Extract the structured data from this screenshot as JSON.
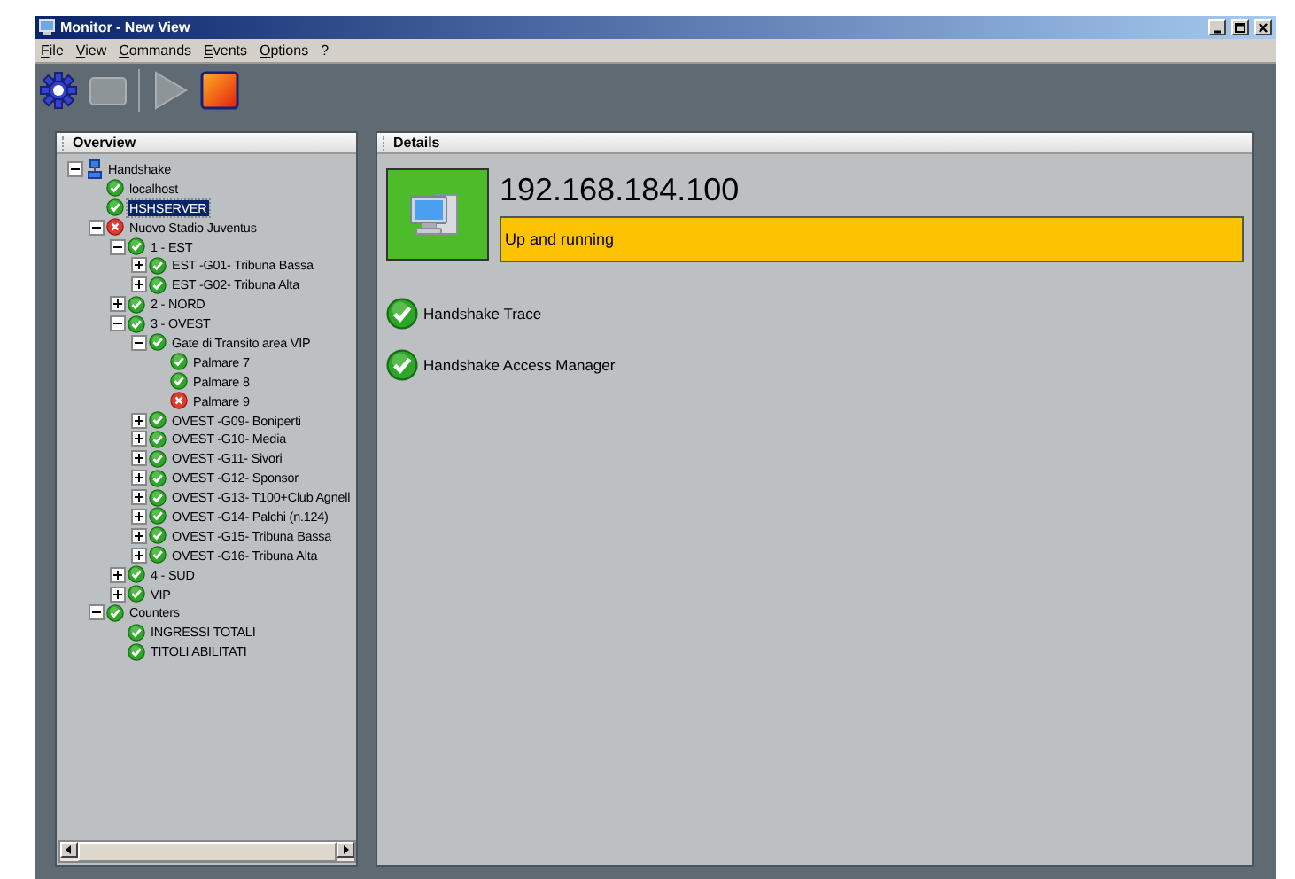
{
  "window": {
    "title": "Monitor - New View"
  },
  "menu": [
    {
      "label": "File"
    },
    {
      "label": "View"
    },
    {
      "label": "Commands"
    },
    {
      "label": "Events"
    },
    {
      "label": "Options"
    },
    {
      "label": "?"
    }
  ],
  "toolbar": [
    {
      "kind": "settings",
      "disabled": false
    },
    {
      "kind": "blank",
      "disabled": true
    },
    {
      "kind": "separator"
    },
    {
      "kind": "play",
      "disabled": true
    },
    {
      "kind": "stop",
      "disabled": false
    }
  ],
  "overview": {
    "title": "Overview",
    "tree": [
      {
        "label": "Handshake",
        "kind": "host",
        "expanded": true,
        "selected": false,
        "children": [
          {
            "label": "localhost",
            "error": false,
            "selected": false
          },
          {
            "label": "HSHSERVER",
            "error": false,
            "selected": true
          },
          {
            "label": "Nuovo Stadio Juventus",
            "error": true,
            "expanded": true,
            "selected": false,
            "children": [
              {
                "label": "1 - EST",
                "error": false,
                "expanded": true,
                "selected": false,
                "children": [
                  {
                    "label": "EST -G01- Tribuna Bassa",
                    "error": false,
                    "expanded": false,
                    "selected": false
                  },
                  {
                    "label": "EST -G02- Tribuna Alta",
                    "error": false,
                    "expanded": false,
                    "selected": false
                  }
                ]
              },
              {
                "label": "2 - NORD",
                "error": false,
                "expanded": false,
                "selected": false
              },
              {
                "label": "3 - OVEST",
                "error": false,
                "expanded": true,
                "selected": false,
                "children": [
                  {
                    "label": "Gate di Transito area VIP",
                    "error": false,
                    "expanded": true,
                    "selected": false,
                    "children": [
                      {
                        "label": "Palmare 7",
                        "error": false,
                        "selected": false
                      },
                      {
                        "label": "Palmare 8",
                        "error": false,
                        "selected": false
                      },
                      {
                        "label": "Palmare 9",
                        "error": true,
                        "selected": false
                      }
                    ]
                  },
                  {
                    "label": "OVEST -G09- Boniperti",
                    "error": false,
                    "expanded": false,
                    "selected": false
                  },
                  {
                    "label": "OVEST -G10- Media",
                    "error": false,
                    "expanded": false,
                    "selected": false
                  },
                  {
                    "label": "OVEST -G11- Sivori",
                    "error": false,
                    "expanded": false,
                    "selected": false
                  },
                  {
                    "label": "OVEST -G12- Sponsor",
                    "error": false,
                    "expanded": false,
                    "selected": false
                  },
                  {
                    "label": "OVEST -G13- T100+Club Agnell",
                    "error": false,
                    "expanded": false,
                    "selected": false
                  },
                  {
                    "label": "OVEST -G14- Palchi (n.124)",
                    "error": false,
                    "expanded": false,
                    "selected": false
                  },
                  {
                    "label": "OVEST -G15- Tribuna Bassa",
                    "error": false,
                    "expanded": false,
                    "selected": false
                  },
                  {
                    "label": "OVEST -G16- Tribuna Alta",
                    "error": false,
                    "expanded": false,
                    "selected": false
                  }
                ]
              },
              {
                "label": "4 - SUD",
                "error": false,
                "expanded": false,
                "selected": false
              },
              {
                "label": "VIP",
                "error": false,
                "expanded": false,
                "selected": false
              }
            ]
          },
          {
            "label": "Counters",
            "error": false,
            "expanded": true,
            "selected": false,
            "children": [
              {
                "label": "INGRESSI TOTALI",
                "error": false,
                "selected": false
              },
              {
                "label": "TITOLI ABILITATI",
                "error": false,
                "selected": false
              }
            ]
          }
        ]
      }
    ]
  },
  "details": {
    "title": "Details",
    "host_error": false,
    "address": "192.168.184.100",
    "status_text": "Up and running",
    "services": [
      {
        "label": "Handshake Trace",
        "error": false
      },
      {
        "label": "Handshake Access Manager",
        "error": false
      }
    ]
  }
}
